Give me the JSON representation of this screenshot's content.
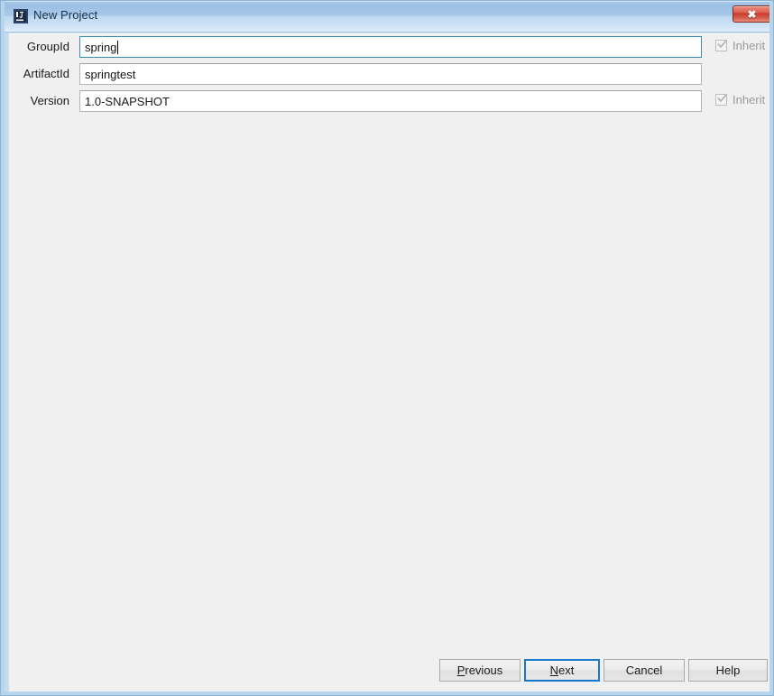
{
  "window": {
    "title": "New Project",
    "icon": "intellij-idea-icon",
    "close_label": "✖",
    "frame_color": "#b6d4ec",
    "titlebar_accent": "#9cbfe3",
    "body_background": "#f0f0f0"
  },
  "form": {
    "fields": [
      {
        "label": "GroupId",
        "value": "spring",
        "placeholder": "",
        "focused": true,
        "has_caret": true,
        "has_inherit": true,
        "inherit_label": "Inherit",
        "inherit_checked": true,
        "inherit_enabled": false
      },
      {
        "label": "ArtifactId",
        "value": "springtest",
        "placeholder": "",
        "focused": false,
        "has_caret": false,
        "has_inherit": false,
        "inherit_label": "",
        "inherit_checked": false,
        "inherit_enabled": false
      },
      {
        "label": "Version",
        "value": "1.0-SNAPSHOT",
        "placeholder": "",
        "focused": false,
        "has_caret": false,
        "has_inherit": true,
        "inherit_label": "Inherit",
        "inherit_checked": true,
        "inherit_enabled": false
      }
    ]
  },
  "buttons": {
    "previous": {
      "label": "Previous",
      "mnemonic": "P",
      "focused": false
    },
    "next": {
      "label": "Next",
      "mnemonic": "N",
      "focused": true
    },
    "cancel": {
      "label": "Cancel",
      "mnemonic": "",
      "focused": false
    },
    "help": {
      "label": "Help",
      "mnemonic": "",
      "focused": false
    }
  },
  "colors": {
    "focus_border": "#1678c8",
    "field_focus_border": "#3d8bb8",
    "close_button": "#c6392a",
    "disabled_text": "#9a9a9a"
  }
}
